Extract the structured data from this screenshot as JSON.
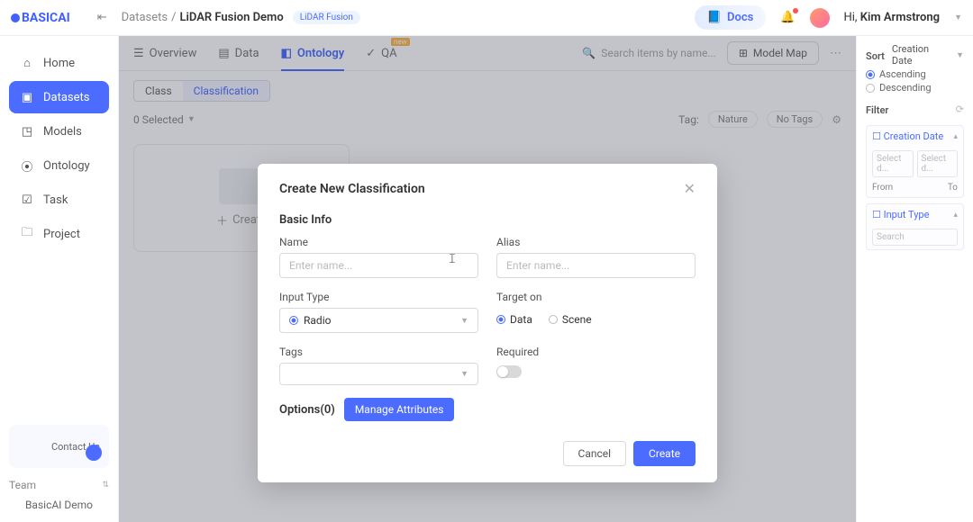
{
  "brand": "BASICAI",
  "breadcrumb": {
    "root": "Datasets",
    "sep": "/",
    "current": "LiDAR Fusion Demo",
    "pill": "LiDAR Fusion"
  },
  "topright": {
    "docs": "Docs",
    "greet_prefix": "Hi, ",
    "username": "Kim Armstrong"
  },
  "sidebar": {
    "items": [
      {
        "label": "Home"
      },
      {
        "label": "Datasets"
      },
      {
        "label": "Models"
      },
      {
        "label": "Ontology"
      },
      {
        "label": "Task"
      },
      {
        "label": "Project"
      }
    ],
    "contact": "Contact Us",
    "team_label": "Team",
    "team_name": "BasicAI Demo"
  },
  "tabs": {
    "overview": "Overview",
    "data": "Data",
    "ontology": "Ontology",
    "qa": "QA",
    "search_ph": "Search items by name...",
    "model_map": "Model Map"
  },
  "ontology": {
    "seg_class": "Class",
    "seg_classification": "Classification",
    "selected": "0 Selected",
    "tag_label": "Tag:",
    "tag_nature": "Nature",
    "tag_none": "No Tags",
    "create": "Create"
  },
  "rightpanel": {
    "sort": "Sort",
    "creation_date": "Creation Date",
    "asc": "Ascending",
    "desc": "Descending",
    "filter": "Filter",
    "sec_creation": "Creation Date",
    "sel_ph": "Select d...",
    "from": "From",
    "to": "To",
    "sec_input": "Input Type",
    "search_ph": "Search"
  },
  "modal": {
    "title": "Create New Classification",
    "section": "Basic Info",
    "name_label": "Name",
    "name_ph": "Enter name...",
    "alias_label": "Alias",
    "alias_ph": "Enter name...",
    "inputtype_label": "Input Type",
    "inputtype_value": "Radio",
    "target_label": "Target on",
    "target_data": "Data",
    "target_scene": "Scene",
    "tags_label": "Tags",
    "required_label": "Required",
    "options_label": "Options(0)",
    "manage": "Manage Attributes",
    "cancel": "Cancel",
    "create": "Create"
  }
}
